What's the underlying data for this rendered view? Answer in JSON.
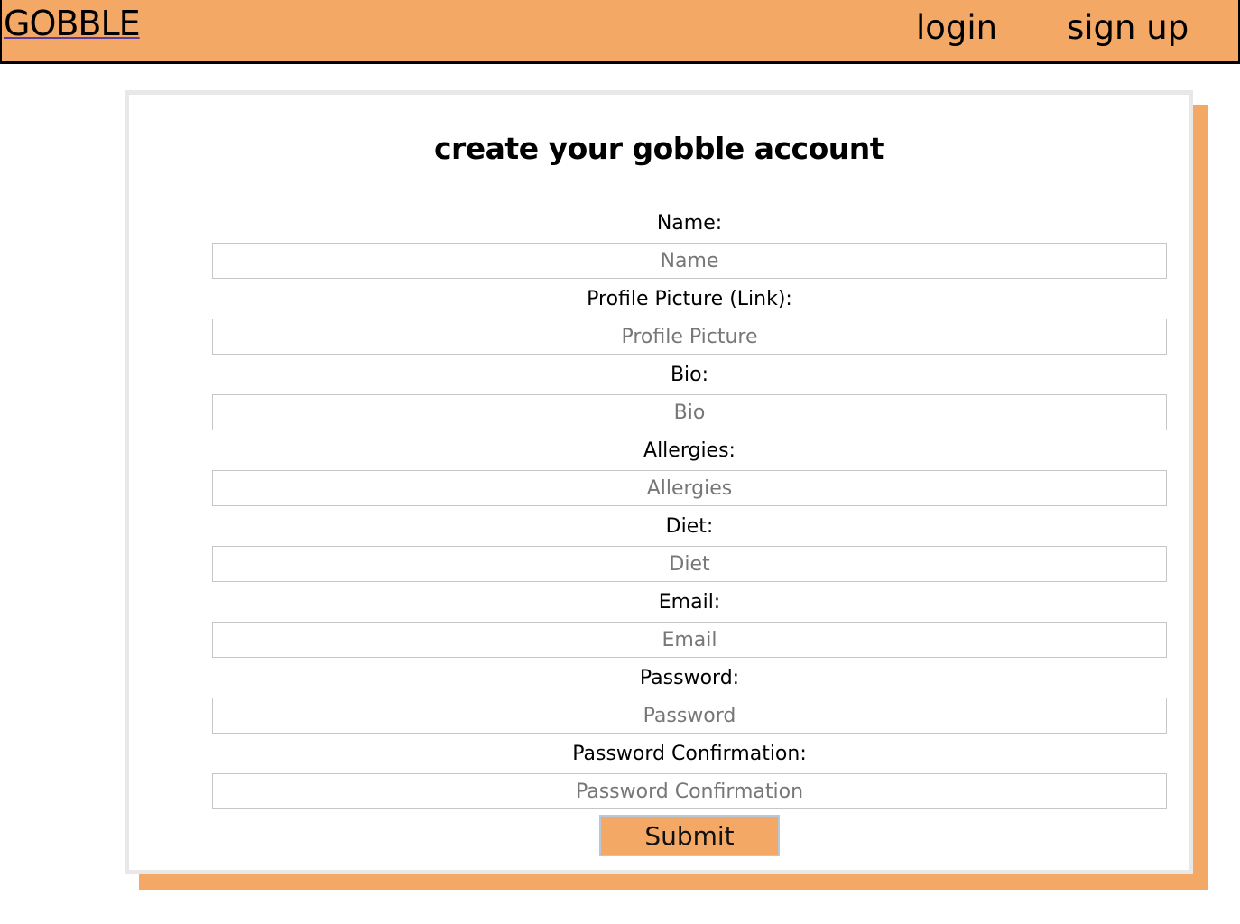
{
  "nav": {
    "brand": "GOBBLE",
    "login": "login",
    "signup": "sign up"
  },
  "form": {
    "title": "create your gobble account",
    "fields": [
      {
        "label": "Name:",
        "placeholder": "Name"
      },
      {
        "label": "Profile Picture (Link):",
        "placeholder": "Profile Picture"
      },
      {
        "label": "Bio:",
        "placeholder": "Bio"
      },
      {
        "label": "Allergies:",
        "placeholder": "Allergies"
      },
      {
        "label": "Diet:",
        "placeholder": "Diet"
      },
      {
        "label": "Email:",
        "placeholder": "Email"
      },
      {
        "label": "Password:",
        "placeholder": "Password"
      },
      {
        "label": "Password Confirmation:",
        "placeholder": "Password Confirmation"
      }
    ],
    "submit_label": "Submit"
  },
  "colors": {
    "accent": "#f3a866",
    "card_border": "#e8e8e8"
  }
}
